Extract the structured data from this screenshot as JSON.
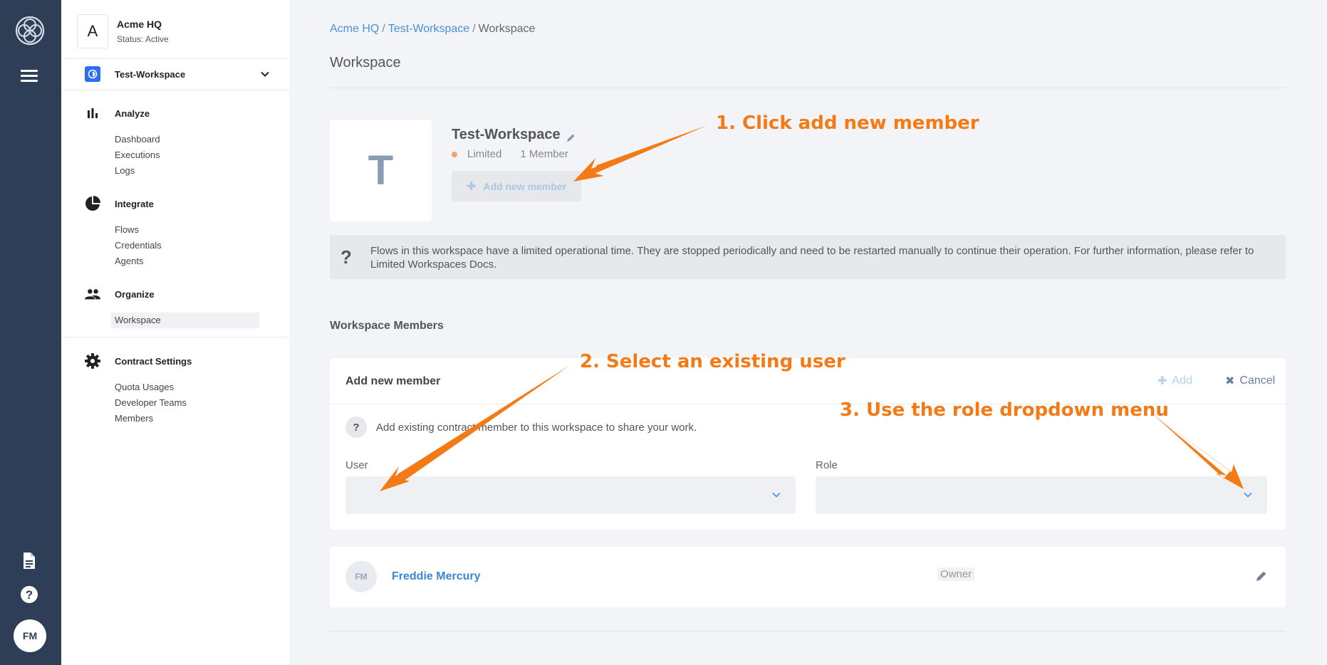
{
  "org": {
    "initial": "A",
    "name": "Acme HQ",
    "status": "Status: Active"
  },
  "workspace_selector": {
    "name": "Test-Workspace"
  },
  "nav": {
    "analyze": {
      "label": "Analyze",
      "items": [
        "Dashboard",
        "Executions",
        "Logs"
      ]
    },
    "integrate": {
      "label": "Integrate",
      "items": [
        "Flows",
        "Credentials",
        "Agents"
      ]
    },
    "organize": {
      "label": "Organize",
      "items": [
        "Workspace"
      ]
    },
    "contract": {
      "label": "Contract Settings",
      "items": [
        "Quota Usages",
        "Developer Teams",
        "Members"
      ]
    }
  },
  "rail": {
    "user_initials": "FM"
  },
  "breadcrumb": {
    "org": "Acme HQ",
    "workspace": "Test-Workspace",
    "current": "Workspace",
    "separator": "/"
  },
  "page_title": "Workspace",
  "workspace": {
    "initial": "T",
    "name": "Test-Workspace",
    "plan": "Limited",
    "member_count": "1 Member",
    "add_member_label": "Add new member"
  },
  "notice": {
    "text": "Flows in this workspace have a limited operational time. They are stopped periodically and need to be restarted manually to continue their operation. For further information, please refer to Limited Workspaces Docs."
  },
  "members_section": {
    "title": "Workspace Members",
    "add_panel": {
      "title": "Add new member",
      "add_label": "Add",
      "cancel_label": "Cancel",
      "hint": "Add existing contract member to this workspace to share your work.",
      "user_label": "User",
      "user_value": "",
      "role_label": "Role",
      "role_value": ""
    },
    "members": [
      {
        "initials": "FM",
        "name": "Freddie Mercury",
        "role": "Owner"
      }
    ]
  },
  "annotations": {
    "step1": "1. Click add new member",
    "step2": "2. Select an existing user",
    "step3": "3. Use the role dropdown menu"
  },
  "colors": {
    "rail": "#2e3e57",
    "link": "#3a87d6",
    "annotation": "#f47a16",
    "limited_dot": "#f5a26a"
  }
}
